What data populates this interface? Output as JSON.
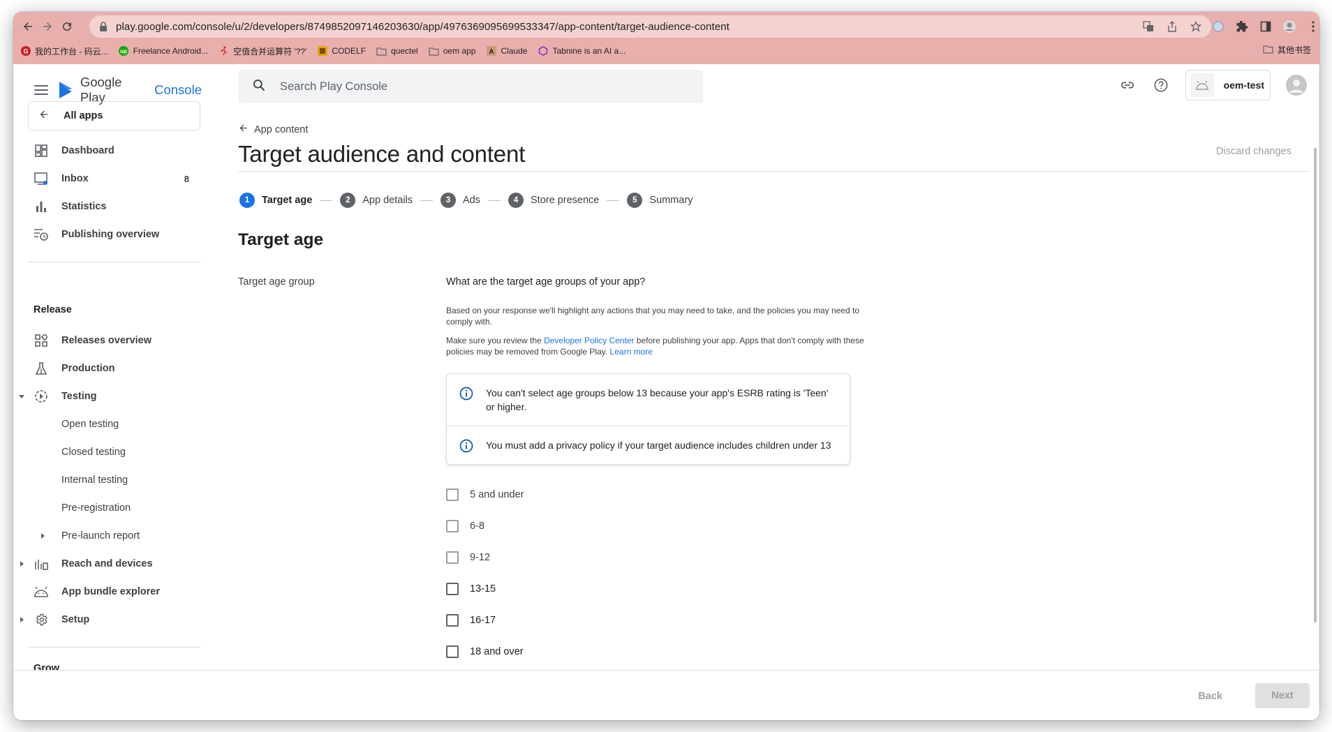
{
  "browser": {
    "url": "play.google.com/console/u/2/developers/8749852097146203630/app/4976369095699533347/app-content/target-audience-content",
    "bookmarks": [
      {
        "label": "我的工作台 - 码云...",
        "icon": "gitee-icon",
        "color": "#c71d23"
      },
      {
        "label": "Freelance Android...",
        "icon": "upwork-icon",
        "color": "#14a800"
      },
      {
        "label": "空值合并运算符 '??'",
        "icon": "runner-icon",
        "color": "#d93025"
      },
      {
        "label": "CODELF",
        "icon": "codelf-icon",
        "color": "#e2a600"
      },
      {
        "label": "quectel",
        "icon": "folder-icon",
        "color": "#5f6368"
      },
      {
        "label": "oem app",
        "icon": "folder-icon",
        "color": "#5f6368"
      },
      {
        "label": "Claude",
        "icon": "anthropic-icon",
        "color": "#202124"
      },
      {
        "label": "Tabnine is an AI a...",
        "icon": "tabnine-icon",
        "color": "#7b2fbe"
      }
    ],
    "other_bookmarks": "其他书签"
  },
  "header": {
    "brand_primary": "Google Play",
    "brand_secondary": "Console",
    "search_placeholder": "Search Play Console",
    "account_name": "oem-test"
  },
  "sidebar": {
    "all_apps": "All apps",
    "items": [
      {
        "label": "Dashboard",
        "icon": "dashboard-icon"
      },
      {
        "label": "Inbox",
        "icon": "inbox-icon",
        "badge": "8"
      },
      {
        "label": "Statistics",
        "icon": "bar-chart-icon"
      },
      {
        "label": "Publishing overview",
        "icon": "publishing-icon"
      }
    ],
    "release_title": "Release",
    "release_items": [
      {
        "label": "Releases overview",
        "icon": "releases-icon"
      },
      {
        "label": "Production",
        "icon": "flask-icon"
      },
      {
        "label": "Testing",
        "icon": "testing-icon"
      },
      {
        "label": "Open testing"
      },
      {
        "label": "Closed testing"
      },
      {
        "label": "Internal testing"
      },
      {
        "label": "Pre-registration"
      },
      {
        "label": "Pre-launch report"
      },
      {
        "label": "Reach and devices",
        "icon": "reach-icon"
      },
      {
        "label": "App bundle explorer",
        "icon": "android-icon"
      },
      {
        "label": "Setup",
        "icon": "gear-icon"
      }
    ],
    "grow_title": "Grow"
  },
  "main": {
    "back_label": "App content",
    "title": "Target audience and content",
    "discard": "Discard changes",
    "steps": [
      {
        "num": "1",
        "label": "Target age",
        "active": true
      },
      {
        "num": "2",
        "label": "App details"
      },
      {
        "num": "3",
        "label": "Ads"
      },
      {
        "num": "4",
        "label": "Store presence"
      },
      {
        "num": "5",
        "label": "Summary"
      }
    ],
    "section_title": "Target age",
    "field_label": "Target age group",
    "question": "What are the target age groups of your app?",
    "help1": "Based on your response we'll highlight any actions that you may need to take, and the policies you may need to comply with.",
    "help2_pre": "Make sure you review the ",
    "help2_link": "Developer Policy Center",
    "help2_mid": " before publishing your app. Apps that don't comply with these policies may be removed from Google Play. ",
    "help2_learn": "Learn more",
    "info": [
      "You can't select age groups below 13 because your app's ESRB rating is 'Teen' or higher.",
      "You must add a privacy policy if your target audience includes children under 13"
    ],
    "age_groups": [
      "5 and under",
      "6-8",
      "9-12",
      "13-15",
      "16-17",
      "18 and over"
    ]
  },
  "footer": {
    "back": "Back",
    "next": "Next"
  }
}
